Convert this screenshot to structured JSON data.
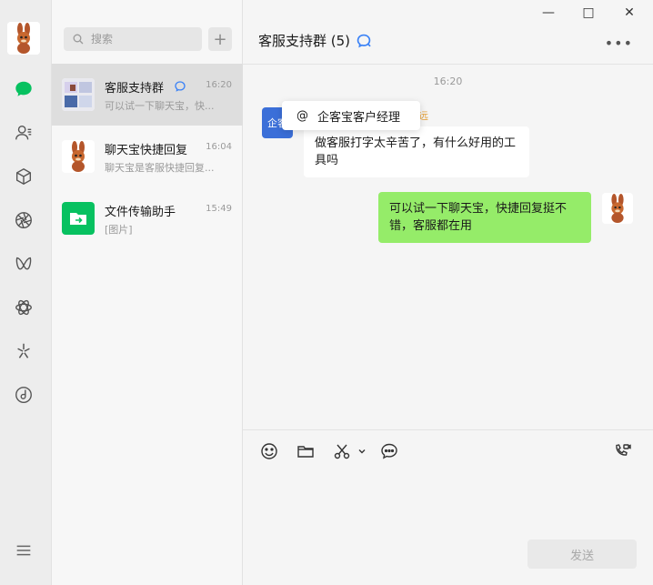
{
  "search": {
    "placeholder": "搜索"
  },
  "conversations": [
    {
      "name": "客服支持群",
      "time": "16:20",
      "preview": "可以试一下聊天宝，快...",
      "active": true
    },
    {
      "name": "聊天宝快捷回复",
      "time": "16:04",
      "preview": "聊天宝是客服快捷回复..."
    },
    {
      "name": "文件传输助手",
      "time": "15:49",
      "preview": "[图片]"
    }
  ],
  "chat": {
    "title": "客服支持群 (5)",
    "timestamp": "16:20",
    "messages": [
      {
        "side": "left",
        "sender": "远",
        "avatar_text": "企客",
        "text": "做客服打字太辛苦了，有什么好用的工具吗"
      },
      {
        "side": "right",
        "text": "可以试一下聊天宝，快捷回复挺不错，客服都在用"
      }
    ],
    "mention": {
      "symbol": "@",
      "label": "企客宝客户经理"
    },
    "send_label": "发送"
  },
  "colors": {
    "accent": "#07c160",
    "bubble_self": "#95ec69",
    "sender_name": "#e6a23c"
  }
}
